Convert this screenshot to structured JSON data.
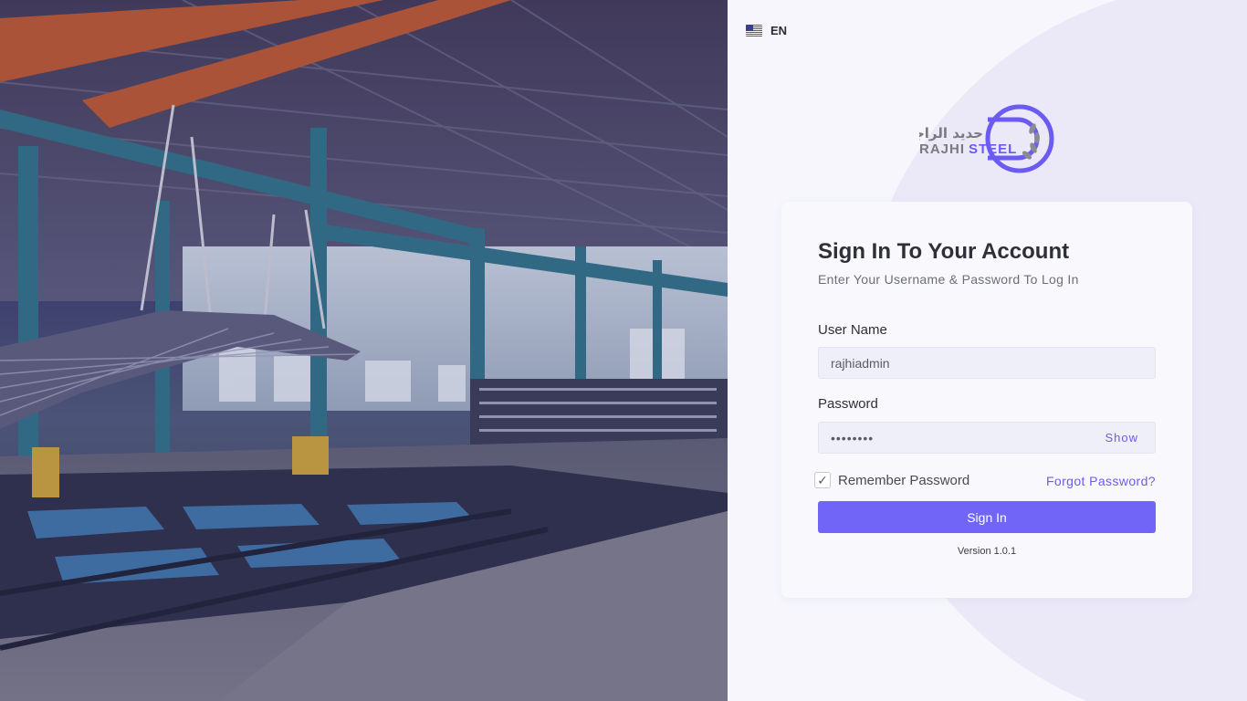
{
  "language": {
    "code": "EN",
    "flag": "us-flag-icon"
  },
  "logo": {
    "arabic": "حديد الراجحي",
    "latin_primary": "RAJHI",
    "latin_secondary": "STEEL"
  },
  "login": {
    "title": "Sign In To Your Account",
    "subtitle": "Enter Your Username & Password To Log In",
    "username_label": "User Name",
    "username_value": "rajhiadmin",
    "password_label": "Password",
    "password_value": "••••••••",
    "show_label": "Show",
    "remember_label": "Remember Password",
    "remember_checked": true,
    "forgot_label": "Forgot Password?",
    "signin_label": "Sign In",
    "version": "Version 1.0.1"
  },
  "colors": {
    "accent": "#7165f8",
    "logo_purple": "#6b5bf2",
    "logo_grey": "#7a7a80"
  }
}
